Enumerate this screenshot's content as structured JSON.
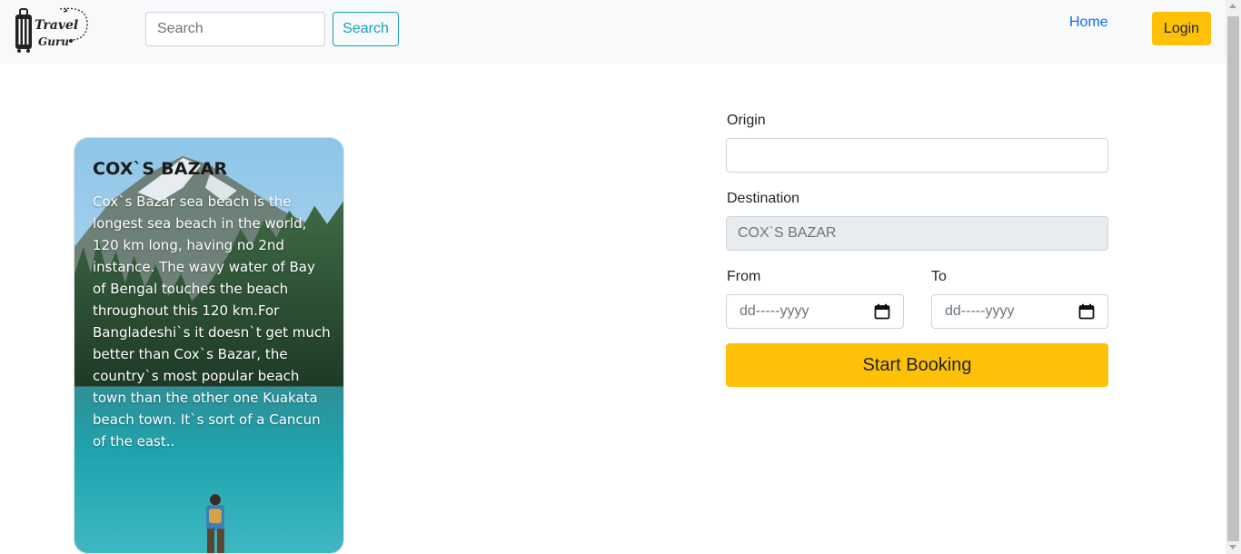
{
  "navbar": {
    "logo_text_line1": "Travel",
    "logo_text_line2": "Guru",
    "search_placeholder": "Search",
    "search_button": "Search",
    "home_link": "Home",
    "login_button": "Login"
  },
  "card": {
    "title": "COX`S BAZAR",
    "description": "Cox`s Bazar sea beach is the longest sea beach in the world, 120 km long, having no 2nd instance. The wavy water of Bay of Bengal touches the beach throughout this 120 km.For Bangladeshi`s it doesn`t get much better than Cox`s Bazar, the country`s most popular beach town than the other one Kuakata beach town. It`s sort of a Cancun of the east.."
  },
  "form": {
    "origin_label": "Origin",
    "origin_value": "",
    "destination_label": "Destination",
    "destination_value": "COX`S BAZAR",
    "from_label": "From",
    "to_label": "To",
    "from_placeholder": "dd-----yyyy",
    "to_placeholder": "dd-----yyyy",
    "submit_label": "Start Booking"
  },
  "colors": {
    "navbar_bg": "#f8f9fa",
    "accent_yellow": "#ffc107",
    "info_teal": "#17a2b8",
    "link_blue": "#0d6efd"
  }
}
